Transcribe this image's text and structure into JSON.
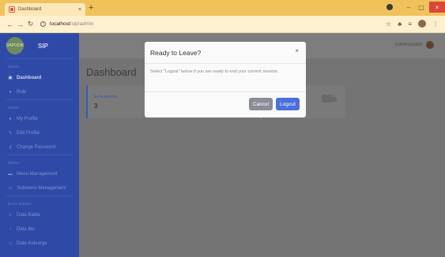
{
  "browser": {
    "tab_title": "Dashboard",
    "tab_close": "×",
    "new_tab": "+",
    "url_host": "localhost",
    "url_path": "/sip/admin",
    "window_controls": [
      "–",
      "▢",
      "×"
    ]
  },
  "sidebar": {
    "brand_name": "SIP",
    "brand_logo_text": "DAPODIK",
    "items": [
      {
        "heading": "MENU",
        "label": "Dashboard",
        "icon": "dashboard-icon",
        "active": true
      },
      {
        "heading": null,
        "label": "Role",
        "icon": "user-icon",
        "active": false
      },
      {
        "heading": "USER",
        "label": "My Profile",
        "icon": "user-icon",
        "active": false
      },
      {
        "heading": null,
        "label": "Edit Profile",
        "icon": "user-edit-icon",
        "active": false
      },
      {
        "heading": null,
        "label": "Change Password",
        "icon": "key-icon",
        "active": false
      },
      {
        "heading": "MENU",
        "label": "Menu Management",
        "icon": "folder-icon",
        "active": false
      },
      {
        "heading": null,
        "label": "Submenu Management",
        "icon": "folder-open-icon",
        "active": false
      },
      {
        "heading": "DATA SISWA",
        "label": "Data Balita",
        "icon": "child-icon",
        "active": false
      },
      {
        "heading": null,
        "label": "Data Ibu",
        "icon": "female-icon",
        "active": false
      },
      {
        "heading": null,
        "label": "Data Keluarga",
        "icon": "home-icon",
        "active": false
      }
    ]
  },
  "topbar": {
    "user_name": "Administrator"
  },
  "main": {
    "page_title": "Dashboard",
    "card": {
      "label": "DATA BALITA",
      "value": "3"
    }
  },
  "modal": {
    "title": "Ready to Leave?",
    "close": "×",
    "body": "Select \"Logout\" below if you are ready to end your current session.",
    "cancel_label": "Cancel",
    "logout_label": "Logout"
  }
}
